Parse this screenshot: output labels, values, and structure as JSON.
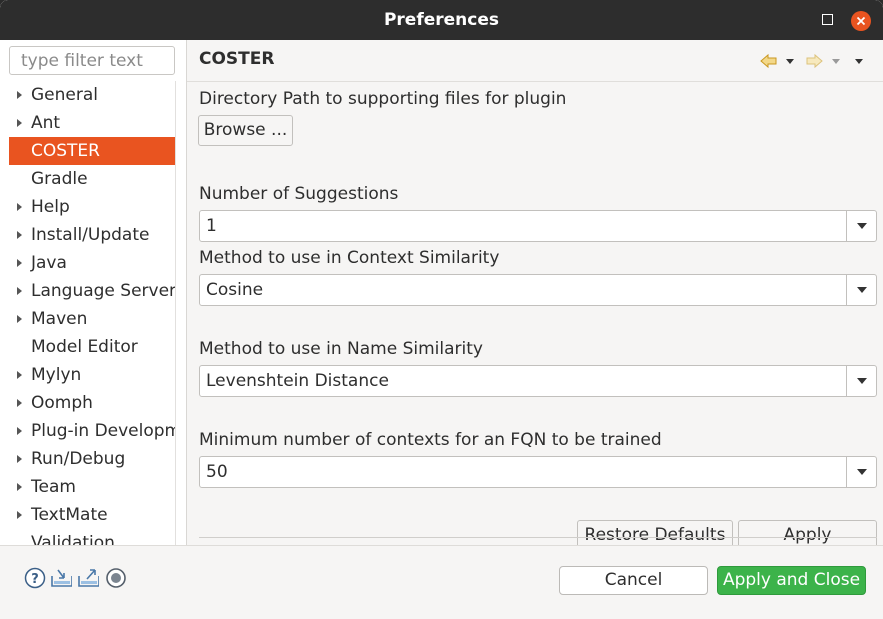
{
  "window": {
    "title": "Preferences"
  },
  "filter": {
    "placeholder": "type filter text"
  },
  "tree": {
    "items": [
      {
        "label": "General",
        "expandable": true,
        "selected": false
      },
      {
        "label": "Ant",
        "expandable": true,
        "selected": false
      },
      {
        "label": "COSTER",
        "expandable": false,
        "selected": true
      },
      {
        "label": "Gradle",
        "expandable": false,
        "selected": false
      },
      {
        "label": "Help",
        "expandable": true,
        "selected": false
      },
      {
        "label": "Install/Update",
        "expandable": true,
        "selected": false
      },
      {
        "label": "Java",
        "expandable": true,
        "selected": false
      },
      {
        "label": "Language Servers",
        "expandable": true,
        "selected": false
      },
      {
        "label": "Maven",
        "expandable": true,
        "selected": false
      },
      {
        "label": "Model Editor",
        "expandable": false,
        "selected": false
      },
      {
        "label": "Mylyn",
        "expandable": true,
        "selected": false
      },
      {
        "label": "Oomph",
        "expandable": true,
        "selected": false
      },
      {
        "label": "Plug-in Development",
        "expandable": true,
        "selected": false
      },
      {
        "label": "Run/Debug",
        "expandable": true,
        "selected": false
      },
      {
        "label": "Team",
        "expandable": true,
        "selected": false
      },
      {
        "label": "TextMate",
        "expandable": true,
        "selected": false
      },
      {
        "label": "Validation",
        "expandable": false,
        "selected": false
      }
    ]
  },
  "page": {
    "title": "COSTER",
    "directory_label": "Directory Path to supporting files for plugin",
    "browse_label": "Browse ...",
    "suggestions_label": "Number of Suggestions",
    "suggestions_value": "1",
    "context_label": "Method to use in Context Similarity",
    "context_value": "Cosine",
    "name_label": "Method to use in Name Similarity",
    "name_value": "Levenshtein Distance",
    "min_contexts_label": "Minimum number of contexts for an FQN to be trained",
    "min_contexts_value": "50",
    "restore_defaults_label": "Restore Defaults",
    "apply_label": "Apply"
  },
  "footer": {
    "cancel_label": "Cancel",
    "apply_close_label": "Apply and Close"
  },
  "colors": {
    "accent": "#e95420",
    "apply_close_bg": "#3cb34a",
    "titlebar_bg": "#2d2d2d",
    "nav_arrow": "#d9a92b"
  },
  "icons": [
    "help-icon",
    "import-icon",
    "export-icon",
    "oomph-record-icon",
    "back-arrow-icon",
    "forward-arrow-icon",
    "view-menu-icon"
  ]
}
